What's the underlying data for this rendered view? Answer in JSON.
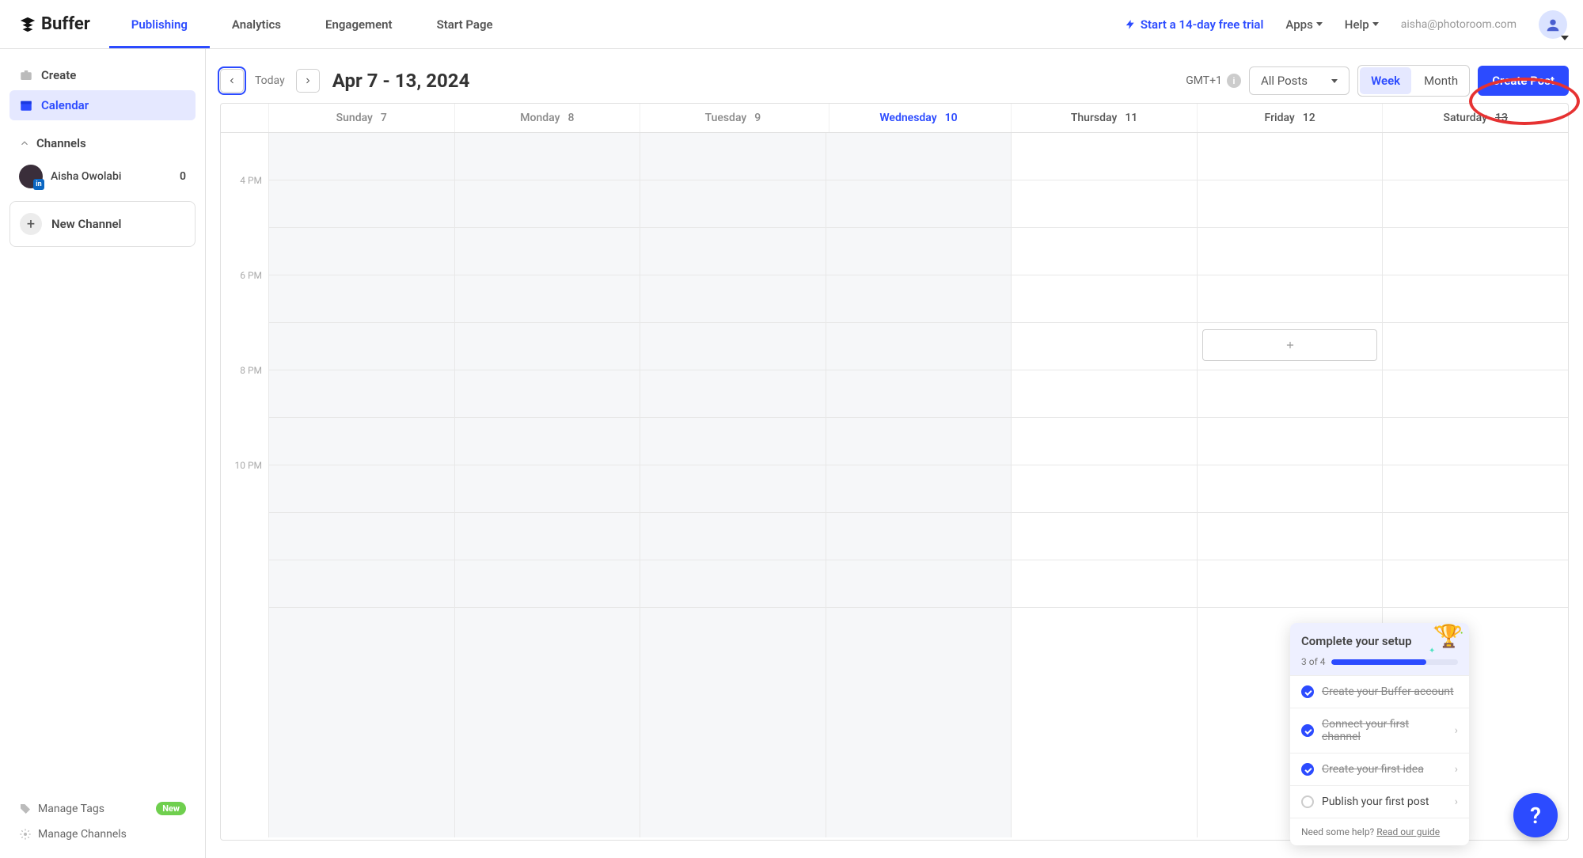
{
  "brand": "Buffer",
  "nav": {
    "tabs": [
      "Publishing",
      "Analytics",
      "Engagement",
      "Start Page"
    ],
    "active": "Publishing",
    "trial": "Start a 14-day free trial",
    "apps": "Apps",
    "help": "Help",
    "email": "aisha@photoroom.com"
  },
  "sidebar": {
    "create": "Create",
    "calendar": "Calendar",
    "channels_label": "Channels",
    "channel": {
      "name": "Aisha Owolabi",
      "count": "0",
      "badge": "in"
    },
    "new_channel": "New Channel",
    "manage_tags": "Manage Tags",
    "new_badge": "New",
    "manage_channels": "Manage Channels"
  },
  "toolbar": {
    "today": "Today",
    "range": "Apr 7 - 13, 2024",
    "tz": "GMT+1",
    "filter": "All Posts",
    "view_week": "Week",
    "view_month": "Month",
    "create_post": "Create Post"
  },
  "calendar": {
    "days": [
      {
        "name": "Sunday",
        "num": "7",
        "state": "past"
      },
      {
        "name": "Monday",
        "num": "8",
        "state": "past"
      },
      {
        "name": "Tuesday",
        "num": "9",
        "state": "past"
      },
      {
        "name": "Wednesday",
        "num": "10",
        "state": "today"
      },
      {
        "name": "Thursday",
        "num": "11",
        "state": ""
      },
      {
        "name": "Friday",
        "num": "12",
        "state": ""
      },
      {
        "name": "Saturday",
        "num": "13",
        "state": "strike"
      }
    ],
    "times": [
      "4 PM",
      "6 PM",
      "8 PM",
      "10 PM"
    ]
  },
  "setup": {
    "title": "Complete your setup",
    "progress_label": "3 of 4",
    "progress_pct": 75,
    "steps": [
      {
        "label": "Create your Buffer account",
        "done": true,
        "nav": false
      },
      {
        "label": "Connect your first channel",
        "done": true,
        "nav": true
      },
      {
        "label": "Create your first idea",
        "done": true,
        "nav": true
      },
      {
        "label": "Publish your first post",
        "done": false,
        "nav": true
      }
    ],
    "help_prefix": "Need some help? ",
    "help_link": "Read our guide"
  },
  "fab": "?"
}
